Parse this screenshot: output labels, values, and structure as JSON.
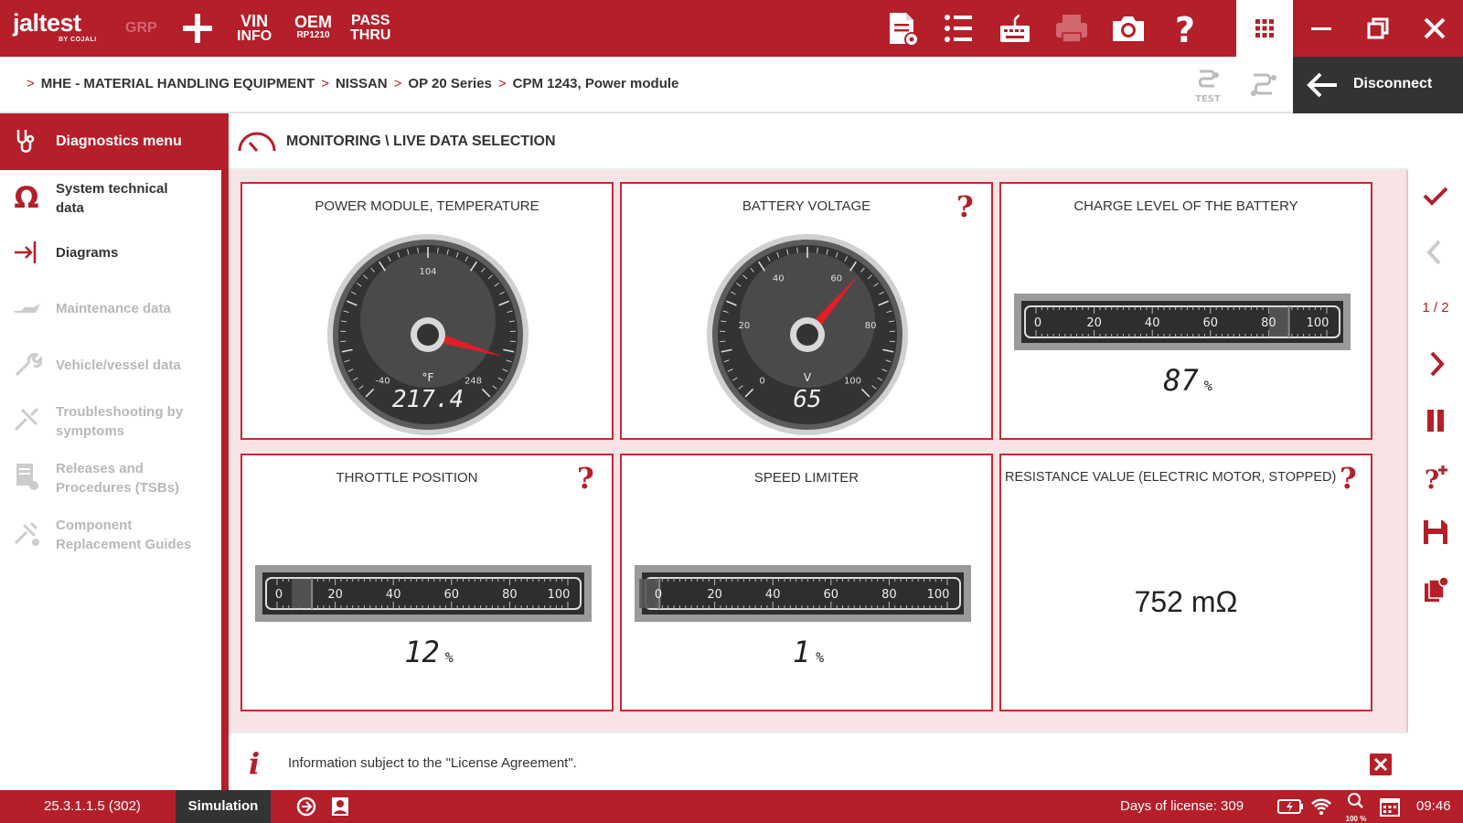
{
  "app": {
    "logo_text": "jaltest",
    "logo_sub": "BY COJALI",
    "grp_label": "GRP",
    "vin_line1": "VIN",
    "vin_line2": "INFO",
    "oem_line1": "OEM",
    "oem_line2": "RP1210",
    "pass_line1": "PASS",
    "pass_line2": "THRU",
    "accent_color": "#b41f2a",
    "dark_color": "#333333"
  },
  "toolbar_icons": [
    "report-icon",
    "list-icon",
    "keyboard-icon",
    "printer-icon",
    "camera-icon",
    "help-icon",
    "apps-grid-icon",
    "minimize-icon",
    "restore-icon",
    "close-icon"
  ],
  "breadcrumb": [
    "MHE - MATERIAL HANDLING EQUIPMENT",
    "NISSAN",
    "OP 20 Series",
    "CPM 1243, Power module"
  ],
  "test_label": "TEST",
  "disconnect_label": "Disconnect",
  "sidebar": {
    "header": "Diagnostics menu",
    "items": [
      {
        "label": "System technical\ndata",
        "enabled": true,
        "icon": "omega-icon"
      },
      {
        "label": "Diagrams",
        "enabled": true,
        "icon": "diagram-icon"
      },
      {
        "label": "Maintenance data",
        "enabled": false,
        "icon": "oil-can-icon"
      },
      {
        "label": "Vehicle/vessel data",
        "enabled": false,
        "icon": "wrench-icon"
      },
      {
        "label": "Troubleshooting by\nsymptoms",
        "enabled": false,
        "icon": "tools-icon"
      },
      {
        "label": "Releases and\nProcedures (TSBs)",
        "enabled": false,
        "icon": "document-icon"
      },
      {
        "label": "Component\nReplacement Guides",
        "enabled": false,
        "icon": "replace-icon"
      }
    ]
  },
  "main": {
    "title": "MONITORING \\ LIVE DATA SELECTION",
    "panels": {
      "temp": {
        "title": "POWER MODULE, TEMPERATURE",
        "unit": "°F",
        "value": "217.4",
        "value_num": 217.4,
        "min": -40,
        "max": 248,
        "ticks": [
          "-40",
          "104",
          "248"
        ]
      },
      "voltage": {
        "title": "BATTERY VOLTAGE",
        "unit": "V",
        "value": "65",
        "value_num": 65,
        "min": 0,
        "max": 100,
        "ticks": [
          "0",
          "20",
          "40",
          "60",
          "80",
          "100"
        ]
      },
      "charge": {
        "title": "CHARGE LEVEL OF THE BATTERY",
        "unit": "%",
        "value": "87",
        "value_num": 87,
        "ticks": [
          "0",
          "20",
          "40",
          "60",
          "80",
          "100"
        ]
      },
      "throttle": {
        "title": "THROTTLE POSITION",
        "unit": "%",
        "value": "12",
        "value_num": 12,
        "ticks": [
          "0",
          "20",
          "40",
          "60",
          "80",
          "100"
        ]
      },
      "speed": {
        "title": "SPEED LIMITER",
        "unit": "%",
        "value": "1",
        "value_num": 1,
        "ticks": [
          "0",
          "20",
          "40",
          "60",
          "80",
          "100"
        ]
      },
      "resistance": {
        "title": "RESISTANCE VALUE (ELECTRIC MOTOR, STOPPED)",
        "value": "752 mΩ"
      }
    }
  },
  "rail": {
    "page": "1 / 2"
  },
  "info": {
    "text": "Information subject to the \"License Agreement\"."
  },
  "status": {
    "version": "25.3.1.1.5 (302)",
    "mode": "Simulation",
    "license": "Days of license: 309",
    "zoom": "100 %",
    "time": "09:46"
  }
}
